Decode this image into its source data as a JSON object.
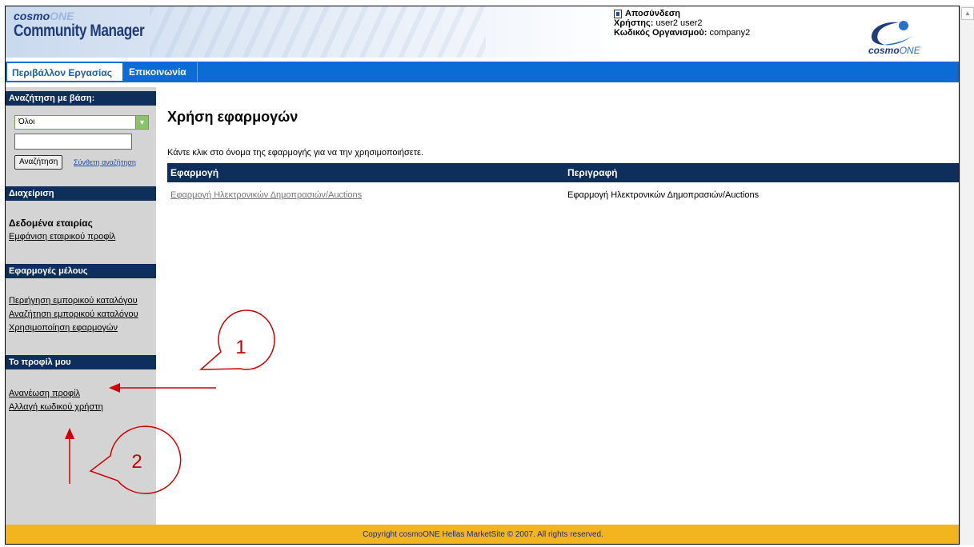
{
  "header": {
    "brand_small": "cosmo",
    "brand_small_accent": "ONE",
    "brand_main": "Community Manager",
    "logout_label": "Αποσύνδεση",
    "user_label": "Χρήστης:",
    "user_value": " user2 user2",
    "org_label": "Κωδικός Οργανισμού:",
    "org_value": " company2",
    "logo_text": "cosmo",
    "logo_text_accent": "ONE"
  },
  "nav": {
    "tabs": [
      {
        "label": "Περιβάλλον Εργασίας"
      },
      {
        "label": "Επικοινωνία"
      }
    ]
  },
  "sidebar": {
    "search_header": "Αναζήτηση με βάση:",
    "search_select_value": "Όλοι",
    "search_input_value": "",
    "search_button": "Αναζήτηση",
    "advanced_search": "Σύνθετη αναζήτηση",
    "admin_header": "Διαχείριση",
    "company_data_title": "Δεδομένα εταιρίας",
    "company_profile_link": "Εμφάνιση εταιρικού προφίλ",
    "member_apps_header": "Εφαρμογές μέλους",
    "member_links": [
      "Περιήγηση εμπορικού καταλόγου",
      "Αναζήτηση εμπορικού καταλόγου",
      "Χρησιμοποίηση εφαρμογών"
    ],
    "profile_header": "Το προφίλ μου",
    "profile_links": [
      "Ανανέωση προφίλ",
      "Αλλαγή κωδικού χρήστη"
    ]
  },
  "main": {
    "title": "Χρήση εφαρμογών",
    "instruction": "Κάντε κλικ στο όνομα της εφαρμογής για να την χρησιμοποιήσετε.",
    "columns": [
      "Εφαρμογή",
      "Περιγραφή"
    ],
    "rows": [
      [
        "Εφαρμογή Ηλεκτρονικών Δημοπρασιών/Auctions",
        "Εφαρμογή Ηλεκτρονικών Δημοπρασιών/Auctions"
      ]
    ]
  },
  "footer": {
    "copyright": "Copyright cosmoONE Hellas MarketSite © 2007. All rights reserved."
  },
  "annotations": {
    "callout_1": "1",
    "callout_2": "2",
    "color": "#c40000"
  }
}
